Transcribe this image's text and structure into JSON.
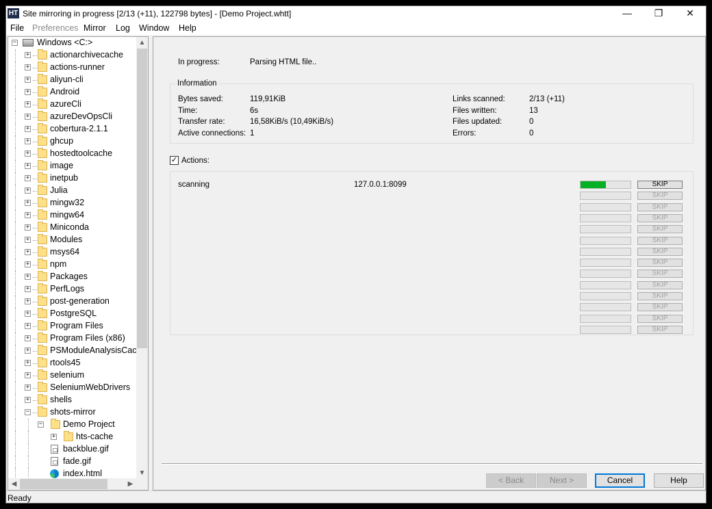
{
  "window": {
    "app_icon_text": "HT",
    "title": "Site mirroring in progress [2/13 (+11), 122798 bytes] - [Demo Project.whtt]",
    "minimize_glyph": "—",
    "maximize_glyph": "❐",
    "close_glyph": "✕"
  },
  "menu": [
    {
      "label": "File",
      "enabled": true
    },
    {
      "label": "Preferences",
      "enabled": false
    },
    {
      "label": "Mirror",
      "enabled": true
    },
    {
      "label": "Log",
      "enabled": true
    },
    {
      "label": "Window",
      "enabled": true
    },
    {
      "label": "Help",
      "enabled": true
    }
  ],
  "tree": {
    "root_label": "Windows <C:>",
    "root_icon": "drive-icon",
    "folders": [
      "actionarchivecache",
      "actions-runner",
      "aliyun-cli",
      "Android",
      "azureCli",
      "azureDevOpsCli",
      "cobertura-2.1.1",
      "ghcup",
      "hostedtoolcache",
      "image",
      "inetpub",
      "Julia",
      "mingw32",
      "mingw64",
      "Miniconda",
      "Modules",
      "msys64",
      "npm",
      "Packages",
      "PerfLogs",
      "post-generation",
      "PostgreSQL",
      "Program Files",
      "Program Files (x86)",
      "PSModuleAnalysisCache",
      "rtools45",
      "selenium",
      "SeleniumWebDrivers",
      "shells",
      "shots-mirror"
    ],
    "project_label": "Demo Project",
    "project_children": [
      {
        "label": "hts-cache",
        "icon": "folder-icon",
        "expandable": true
      },
      {
        "label": "backblue.gif",
        "icon": "file-icon",
        "expandable": false
      },
      {
        "label": "fade.gif",
        "icon": "file-icon",
        "expandable": false
      },
      {
        "label": "index.html",
        "icon": "edge-icon",
        "expandable": false
      }
    ]
  },
  "progress": {
    "in_progress_label": "In progress:",
    "in_progress_value": "Parsing HTML file..",
    "info_title": "Information",
    "left_stats": [
      {
        "label": "Bytes saved:",
        "value": "119,91KiB"
      },
      {
        "label": "Time:",
        "value": "6s"
      },
      {
        "label": "Transfer rate:",
        "value": "16,58KiB/s (10,49KiB/s)"
      },
      {
        "label": "Active connections:",
        "value": "1"
      }
    ],
    "right_stats": [
      {
        "label": "Links scanned:",
        "value": "2/13 (+11)"
      },
      {
        "label": "Files written:",
        "value": "13"
      },
      {
        "label": "Files updated:",
        "value": "0"
      },
      {
        "label": "Errors:",
        "value": "0"
      }
    ],
    "actions_label": "Actions:",
    "actions_checked": true,
    "action_rows": [
      {
        "status": "scanning",
        "url": "127.0.0.1:8099",
        "progress": 0.5,
        "skip_label": "SKIP",
        "skip_enabled": true
      },
      {
        "status": "",
        "url": "",
        "progress": 0,
        "skip_label": "SKIP",
        "skip_enabled": false
      },
      {
        "status": "",
        "url": "",
        "progress": 0,
        "skip_label": "SKIP",
        "skip_enabled": false
      },
      {
        "status": "",
        "url": "",
        "progress": 0,
        "skip_label": "SKIP",
        "skip_enabled": false
      },
      {
        "status": "",
        "url": "",
        "progress": 0,
        "skip_label": "SKIP",
        "skip_enabled": false
      },
      {
        "status": "",
        "url": "",
        "progress": 0,
        "skip_label": "SKIP",
        "skip_enabled": false
      },
      {
        "status": "",
        "url": "",
        "progress": 0,
        "skip_label": "SKIP",
        "skip_enabled": false
      },
      {
        "status": "",
        "url": "",
        "progress": 0,
        "skip_label": "SKIP",
        "skip_enabled": false
      },
      {
        "status": "",
        "url": "",
        "progress": 0,
        "skip_label": "SKIP",
        "skip_enabled": false
      },
      {
        "status": "",
        "url": "",
        "progress": 0,
        "skip_label": "SKIP",
        "skip_enabled": false
      },
      {
        "status": "",
        "url": "",
        "progress": 0,
        "skip_label": "SKIP",
        "skip_enabled": false
      },
      {
        "status": "",
        "url": "",
        "progress": 0,
        "skip_label": "SKIP",
        "skip_enabled": false
      },
      {
        "status": "",
        "url": "",
        "progress": 0,
        "skip_label": "SKIP",
        "skip_enabled": false
      },
      {
        "status": "",
        "url": "",
        "progress": 0,
        "skip_label": "SKIP",
        "skip_enabled": false
      }
    ]
  },
  "buttons": {
    "back": {
      "label": "< Back",
      "enabled": false
    },
    "next": {
      "label": "Next >",
      "enabled": false
    },
    "cancel": {
      "label": "Cancel",
      "enabled": true
    },
    "help": {
      "label": "Help",
      "enabled": true
    }
  },
  "status": {
    "text": "Ready"
  },
  "colors": {
    "progress_fill": "#06b025",
    "default_button_border": "#0078d7"
  }
}
